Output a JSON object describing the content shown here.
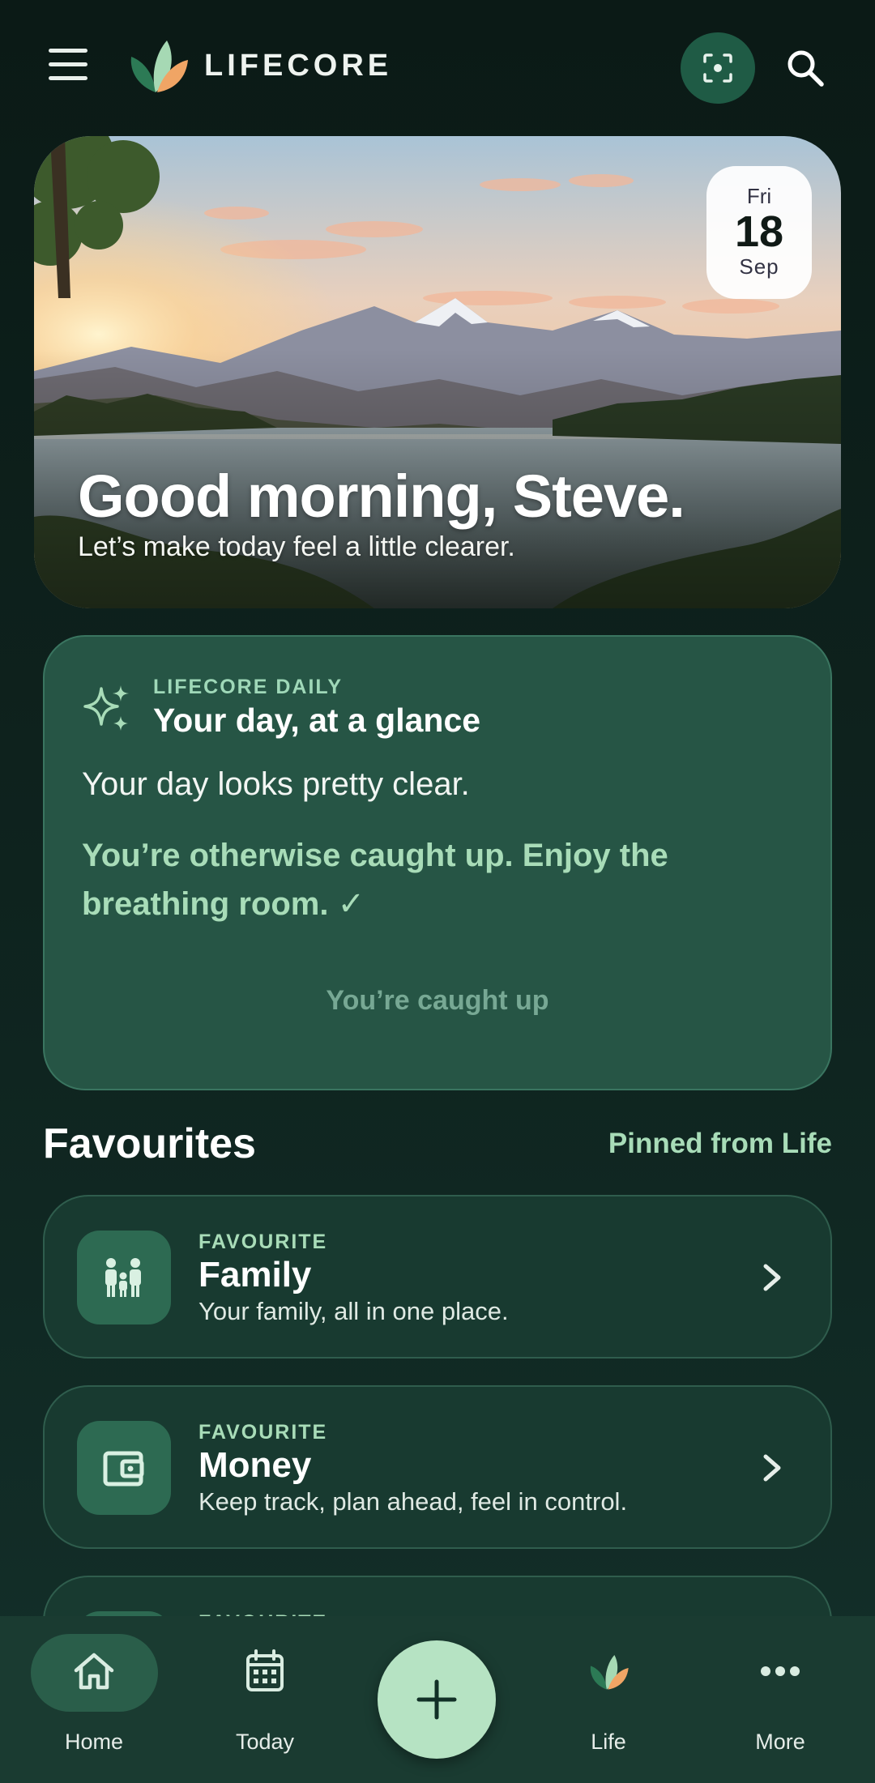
{
  "app": {
    "brand": "LIFECORE"
  },
  "hero": {
    "date": {
      "dow": "Fri",
      "day": "18",
      "month": "Sep"
    },
    "greeting": "Good morning, Steve.",
    "subtitle": "Let’s make today feel a little clearer."
  },
  "daily": {
    "kicker": "LIFECORE DAILY",
    "title": "Your day, at a glance",
    "line1": "Your day looks pretty clear.",
    "line2": "You’re otherwise caught up. Enjoy the breathing room. ✓",
    "caught_up": "You’re caught up"
  },
  "favourites": {
    "title": "Favourites",
    "link": "Pinned from Life",
    "items": [
      {
        "kicker": "FAVOURITE",
        "name": "Family",
        "desc": "Your family, all in one place.",
        "icon": "family-icon"
      },
      {
        "kicker": "FAVOURITE",
        "name": "Money",
        "desc": "Keep track, plan ahead, feel in control.",
        "icon": "wallet-icon"
      },
      {
        "kicker": "FAVOURITE",
        "name": "",
        "desc": "",
        "icon": ""
      }
    ]
  },
  "nav": {
    "items": [
      {
        "label": "Home",
        "icon": "home-icon",
        "active": true
      },
      {
        "label": "Today",
        "icon": "calendar-icon"
      },
      {
        "label": "Life",
        "icon": "leaf-logo-icon"
      },
      {
        "label": "More",
        "icon": "more-dots-icon"
      }
    ],
    "fab_icon": "plus-icon"
  },
  "colors": {
    "accent": "#b6e3c3",
    "card": "#265545",
    "background": "#0f2520",
    "muted_green": "#a8dcb8"
  }
}
